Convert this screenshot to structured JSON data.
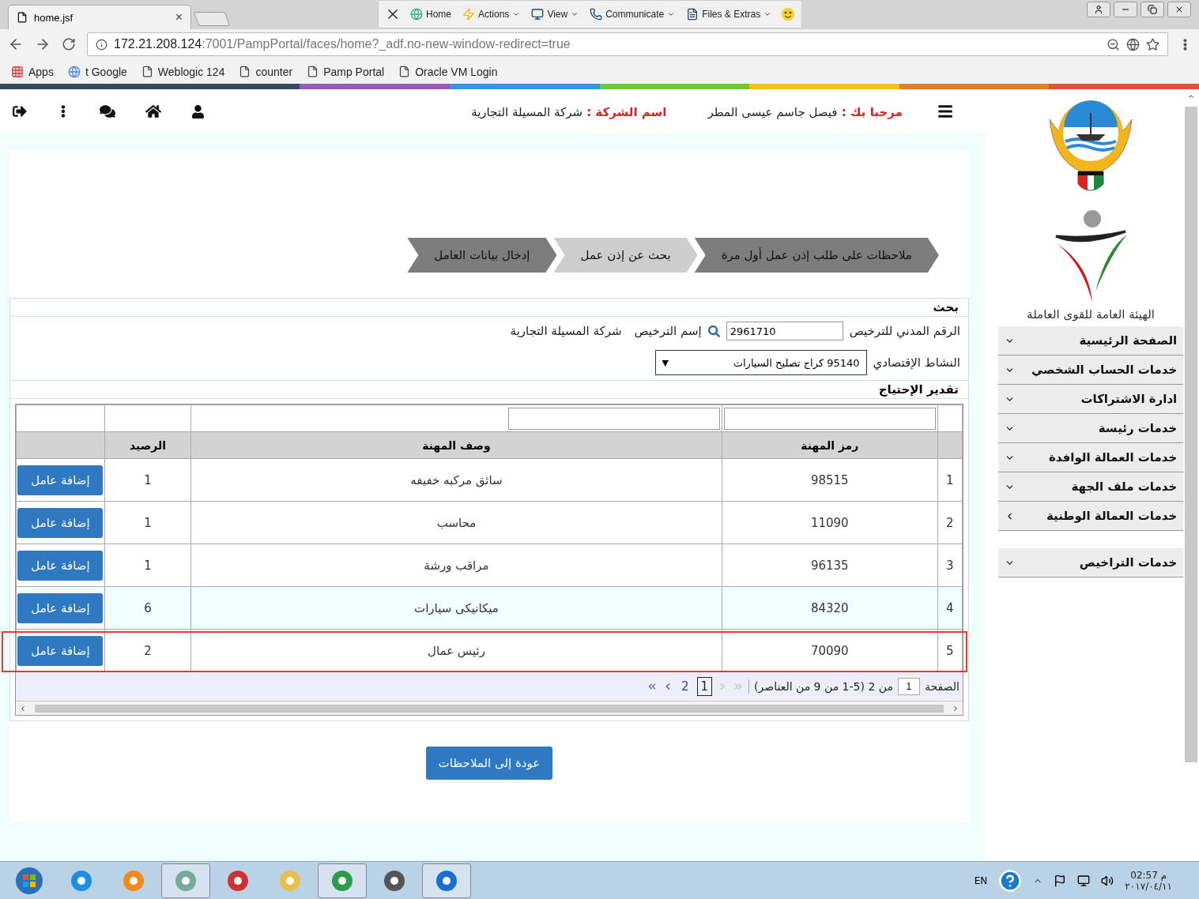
{
  "browser": {
    "tab_title": "home.jsf",
    "tab_close": "×",
    "toolbar": [
      {
        "kind": "files",
        "label": "Files & Extras",
        "menu": true
      },
      {
        "kind": "communicate",
        "label": "Communicate",
        "menu": true
      },
      {
        "kind": "view",
        "label": "View",
        "menu": true
      },
      {
        "kind": "actions",
        "label": "Actions",
        "menu": true
      },
      {
        "kind": "home",
        "label": "Home",
        "menu": false
      }
    ],
    "url_host": "172.21.208.124",
    "url_rest": ":7001/PampPortal/faces/home?_adf.no-new-window-redirect=true",
    "bookmarks": [
      {
        "kind": "page",
        "label": "Oracle VM Login"
      },
      {
        "kind": "page",
        "label": "Pamp Portal"
      },
      {
        "kind": "page",
        "label": "counter"
      },
      {
        "kind": "page",
        "label": "Weblogic 124"
      },
      {
        "kind": "google",
        "label": "t Google"
      },
      {
        "kind": "apps",
        "label": "Apps"
      }
    ]
  },
  "header": {
    "welcome_label": "مرحبا بك :",
    "user_name": "فيصل جاسم عيسى المطر",
    "company_label": "اسم الشركة :",
    "company_name": "شركة المسيلة التجارية"
  },
  "steps": [
    {
      "label": "ملاحظات على طلب إذن عمل أول مرة",
      "selected": false
    },
    {
      "label": "بحث عن إذن عمل",
      "selected": true
    },
    {
      "label": "إدخال بيانات العامل",
      "selected": false
    }
  ],
  "search": {
    "title": "بحث",
    "civil_id_label": "الرقم المدني للترخيص",
    "civil_id_value": "2961710",
    "license_name_label": "إسم الترخيص",
    "license_name_value": "شركة المسيلة التجارية",
    "activity_label": "النشاط الإقتصادي",
    "activity_value": "95140 كراج تصليح السيارات",
    "activity_arrow": "▼"
  },
  "needs": {
    "title": "تقدير الإحتياج",
    "columns": [
      "رمز المهنة",
      "وصف المهنة",
      "الرصيد"
    ],
    "rows": [
      {
        "index": "1",
        "code": "98515",
        "description": "سائق مركبه خفيفه",
        "balance": "1",
        "action": "إضافة عامل",
        "selected": false,
        "outlined": false
      },
      {
        "index": "2",
        "code": "11090",
        "description": "محاسب",
        "balance": "1",
        "action": "إضافة عامل",
        "selected": false,
        "outlined": false
      },
      {
        "index": "3",
        "code": "96135",
        "description": "مراقب ورشة",
        "balance": "1",
        "action": "إضافة عامل",
        "selected": false,
        "outlined": false
      },
      {
        "index": "4",
        "code": "84320",
        "description": "ميكانيكى سيارات",
        "balance": "6",
        "action": "إضافة عامل",
        "selected": true,
        "outlined": false
      },
      {
        "index": "5",
        "code": "70090",
        "description": "رئيس عمال",
        "balance": "2",
        "action": "إضافة عامل",
        "selected": false,
        "outlined": true
      }
    ],
    "pagination": {
      "page_label": "الصفحة",
      "page_value": "1",
      "summary": "من 2 (5-1 من 9 من العناصر)",
      "pages": [
        {
          "label": "1",
          "selected": true
        },
        {
          "label": "2",
          "selected": false
        }
      ],
      "nav": [
        {
          "kind": "first",
          "disabled": true
        },
        {
          "kind": "previous",
          "disabled": true
        },
        {
          "kind": "next",
          "disabled": false
        },
        {
          "kind": "last",
          "disabled": false
        }
      ]
    }
  },
  "back_button": "عودة إلى الملاحظات",
  "sidebar": {
    "org_name": "الهيئة العامة للقوى العاملة",
    "items": [
      {
        "label": "الصفحة الرئيسية",
        "kind": "dropdown"
      },
      {
        "label": "خدمات الحساب الشخصي",
        "kind": "dropdown"
      },
      {
        "label": "ادارة الاشتراكات",
        "kind": "dropdown"
      },
      {
        "label": "خدمات رئيسة",
        "kind": "dropdown"
      },
      {
        "label": "خدمات العمالة الوافدة",
        "kind": "dropdown"
      },
      {
        "label": "خدمات ملف الجهة",
        "kind": "dropdown"
      },
      {
        "label": "خدمات العمالة الوطنية",
        "kind": "link"
      }
    ],
    "extra_items": [
      {
        "label": "خدمات التراخيص",
        "kind": "dropdown"
      }
    ]
  },
  "taskbar": {
    "language": "EN",
    "time": "02:57 م",
    "date": "٢٠١٧/٠٤/١١"
  }
}
